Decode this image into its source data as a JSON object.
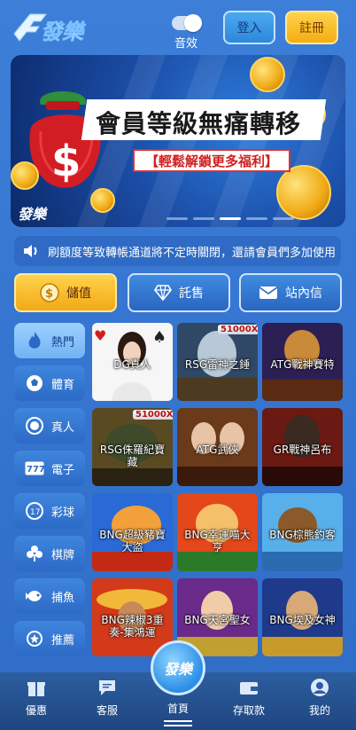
{
  "header": {
    "logo_text": "發樂",
    "sound_label": "音效",
    "login_label": "登入",
    "register_label": "註冊"
  },
  "banner": {
    "title": "會員等級無痛轉移",
    "subtitle": "【輕鬆解鎖更多福利】",
    "logo_text": "發樂",
    "slide_count": 5,
    "active_slide": 3
  },
  "marquee": {
    "text": "刷額度等致轉帳通道將不定時關閉，還請會員們多加使用"
  },
  "actions": {
    "deposit": "儲值",
    "withdraw": "託售",
    "message": "站內信"
  },
  "categories": [
    {
      "label": "熱門",
      "icon": "fire-icon",
      "active": true
    },
    {
      "label": "體育",
      "icon": "soccer-ball-icon",
      "active": false
    },
    {
      "label": "真人",
      "icon": "chip-icon",
      "active": false
    },
    {
      "label": "電子",
      "icon": "slot-777-icon",
      "active": false
    },
    {
      "label": "彩球",
      "icon": "lottery-ball-icon",
      "active": false
    },
    {
      "label": "棋牌",
      "icon": "card-suits-icon",
      "active": false
    },
    {
      "label": "捕魚",
      "icon": "fish-icon",
      "active": false
    },
    {
      "label": "推薦",
      "icon": "medal-icon",
      "active": false
    }
  ],
  "games": [
    {
      "name": "DG真人",
      "badge": "",
      "bg": "#f4f4f4"
    },
    {
      "name": "RSG雷神之錘",
      "badge": "51000X",
      "bg": "#3a5878"
    },
    {
      "name": "ATG戰神賽特",
      "badge": "",
      "bg": "#3b2a6a"
    },
    {
      "name": "RSG侏羅紀寶藏",
      "badge": "51000X",
      "bg": "#6b5a2a"
    },
    {
      "name": "ATG武俠",
      "badge": "",
      "bg": "#5a3a1a"
    },
    {
      "name": "GR戰神呂布",
      "badge": "",
      "bg": "#6a1a12"
    },
    {
      "name": "BNG超級豬寶大盜",
      "badge": "",
      "bg": "#d9431e"
    },
    {
      "name": "BNG幸運喵大亨",
      "badge": "",
      "bg": "#c8401a"
    },
    {
      "name": "BNG棕熊釣客",
      "badge": "",
      "bg": "#2a8ad6"
    },
    {
      "name": "BNG辣椒3重奏-集鴻運",
      "badge": "",
      "bg": "#b4321a"
    },
    {
      "name": "BNG天宮聖女",
      "badge": "",
      "bg": "#7a2a9a"
    },
    {
      "name": "BNG埃及女神",
      "badge": "",
      "bg": "#2a4ab0"
    }
  ],
  "bottom_nav": {
    "promo": "優惠",
    "service": "客服",
    "home": "首頁",
    "withdraw": "存取款",
    "mine": "我的"
  }
}
